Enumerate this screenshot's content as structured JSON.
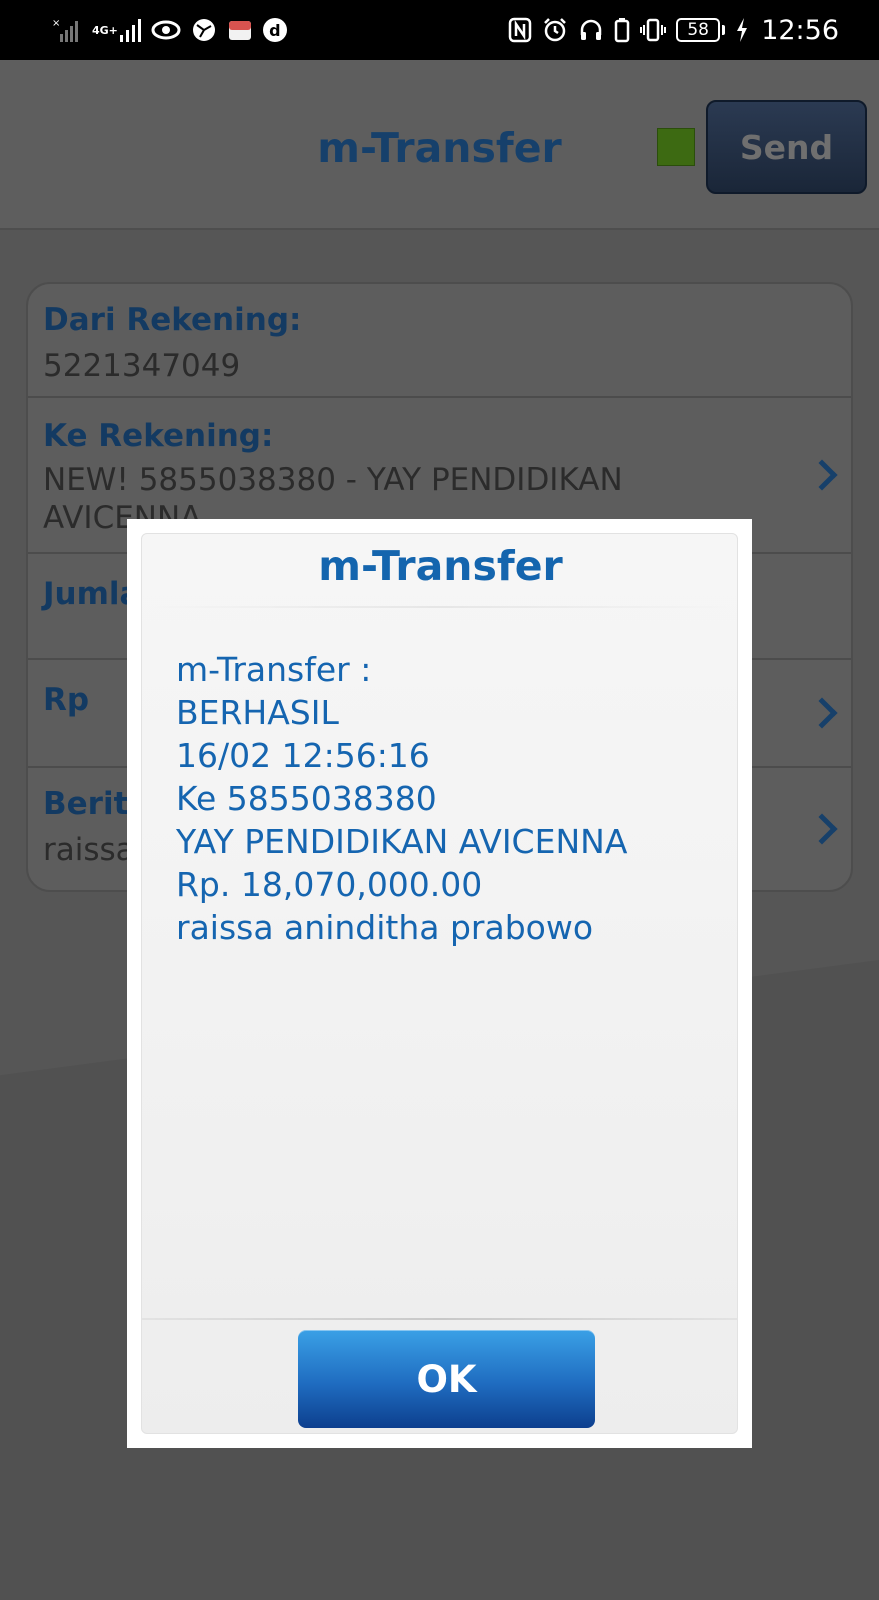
{
  "status_bar": {
    "time": "12:56",
    "battery": "58",
    "network_label": "4G+",
    "left_icons": [
      "no-sim-signal-icon",
      "signal-icon",
      "eye-icon",
      "vpn-globe-icon",
      "app-notification-icon",
      "d-app-icon"
    ],
    "right_icons": [
      "nfc-icon",
      "alarm-icon",
      "headphones-icon",
      "battery-saver-icon",
      "vibrate-icon",
      "battery-icon",
      "charging-icon"
    ]
  },
  "header": {
    "title": "m-Transfer",
    "send_label": "Send",
    "status_color": "#3d6a12"
  },
  "form": {
    "from_label": "Dari Rekening:",
    "from_value": "5221347049",
    "to_label": "Ke Rekening:",
    "to_value_line1": "NEW! 5855038380 - YAY PENDIDIKAN",
    "to_value_line2": "AVICENNA",
    "amount_label": "Jumlah",
    "currency_label": "Rp",
    "news_label": "Berita",
    "news_value": "raissa aninditha prabowo"
  },
  "dialog": {
    "title": "m-Transfer",
    "lines": [
      "m-Transfer :",
      "BERHASIL",
      "16/02 12:56:16",
      "Ke 5855038380",
      "YAY PENDIDIKAN AVICENNA",
      "Rp. 18,070,000.00",
      "raissa aninditha prabowo"
    ],
    "ok_label": "OK"
  },
  "colors": {
    "accent": "#1565b0",
    "title_blue": "#1465ae",
    "ok_button": "#1f6cc0"
  }
}
